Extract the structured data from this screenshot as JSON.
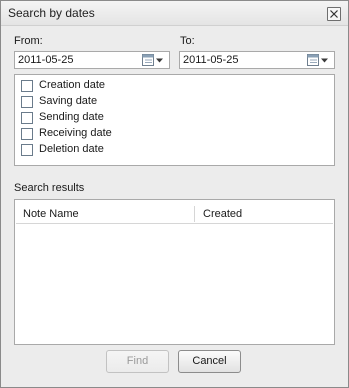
{
  "window": {
    "title": "Search by dates"
  },
  "from": {
    "label": "From:",
    "value": "2011-05-25"
  },
  "to": {
    "label": "To:",
    "value": "2011-05-25"
  },
  "date_types": [
    {
      "label": "Creation date",
      "checked": false
    },
    {
      "label": "Saving date",
      "checked": false
    },
    {
      "label": "Sending date",
      "checked": false
    },
    {
      "label": "Receiving date",
      "checked": false
    },
    {
      "label": "Deletion date",
      "checked": false
    }
  ],
  "results": {
    "label": "Search results",
    "columns": [
      "Note Name",
      "Created"
    ],
    "rows": []
  },
  "buttons": {
    "find": "Find",
    "cancel": "Cancel"
  },
  "icons": {
    "close": "close-icon",
    "calendar": "calendar-icon",
    "dropdown": "chevron-down-icon"
  }
}
